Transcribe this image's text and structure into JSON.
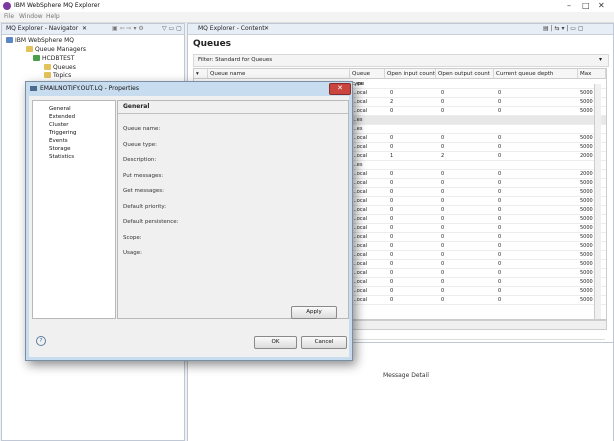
{
  "app": {
    "title": "IBM WebSphere MQ Explorer"
  },
  "menu": [
    "File",
    "Window",
    "Help"
  ],
  "navigator": {
    "title": "MQ Explorer - Navigator",
    "tree": [
      {
        "label": "IBM WebSphere MQ",
        "icon": "mq-root-icon"
      },
      {
        "label": "Queue Managers",
        "icon": "folder-icon"
      },
      {
        "label": "HCDBTEST",
        "icon": "queue-manager-icon"
      },
      {
        "label": "Queues",
        "icon": "folder-icon"
      },
      {
        "label": "Topics",
        "icon": "folder-icon"
      }
    ]
  },
  "content": {
    "title": "MQ Explorer - Content",
    "heading": "Queues",
    "filter": "Filter: Standard for Queues",
    "columns": [
      "Queue name",
      "Queue type",
      "Open input count",
      "Open output count",
      "Current queue depth",
      "Max"
    ],
    "rows": [
      {
        "type": "...es",
        "in": "",
        "out": "",
        "depth": "",
        "max": "",
        "grey": false
      },
      {
        "type": "...ocal",
        "in": "0",
        "out": "0",
        "depth": "0",
        "max": "5000",
        "grey": false
      },
      {
        "type": "...ocal",
        "in": "2",
        "out": "0",
        "depth": "0",
        "max": "5000",
        "grey": false
      },
      {
        "type": "...ocal",
        "in": "0",
        "out": "0",
        "depth": "0",
        "max": "5000",
        "grey": false
      },
      {
        "type": "...es",
        "in": "",
        "out": "",
        "depth": "",
        "max": "",
        "grey": true
      },
      {
        "type": "...es",
        "in": "",
        "out": "",
        "depth": "",
        "max": "",
        "grey": false
      },
      {
        "type": "...ocal",
        "in": "0",
        "out": "0",
        "depth": "0",
        "max": "5000",
        "grey": false
      },
      {
        "type": "...ocal",
        "in": "0",
        "out": "0",
        "depth": "0",
        "max": "5000",
        "grey": false
      },
      {
        "type": "...ocal",
        "in": "1",
        "out": "2",
        "depth": "0",
        "max": "2000",
        "grey": false
      },
      {
        "type": "...es",
        "in": "",
        "out": "",
        "depth": "",
        "max": "",
        "grey": false
      },
      {
        "type": "...ocal",
        "in": "0",
        "out": "0",
        "depth": "0",
        "max": "2000",
        "grey": false
      },
      {
        "type": "...ocal",
        "in": "0",
        "out": "0",
        "depth": "0",
        "max": "5000",
        "grey": false
      },
      {
        "type": "...ocal",
        "in": "0",
        "out": "0",
        "depth": "0",
        "max": "5000",
        "grey": false
      },
      {
        "type": "...ocal",
        "in": "0",
        "out": "0",
        "depth": "0",
        "max": "5000",
        "grey": false
      },
      {
        "type": "...ocal",
        "in": "0",
        "out": "0",
        "depth": "0",
        "max": "5000",
        "grey": false
      },
      {
        "type": "...ocal",
        "in": "0",
        "out": "0",
        "depth": "0",
        "max": "5000",
        "grey": false
      },
      {
        "type": "...ocal",
        "in": "0",
        "out": "0",
        "depth": "0",
        "max": "5000",
        "grey": false
      },
      {
        "type": "...ocal",
        "in": "0",
        "out": "0",
        "depth": "0",
        "max": "5000",
        "grey": false
      },
      {
        "type": "...ocal",
        "in": "0",
        "out": "0",
        "depth": "0",
        "max": "5000",
        "grey": false
      },
      {
        "type": "...ocal",
        "in": "0",
        "out": "0",
        "depth": "0",
        "max": "5000",
        "grey": false
      },
      {
        "type": "...ocal",
        "in": "0",
        "out": "0",
        "depth": "0",
        "max": "5000",
        "grey": false
      },
      {
        "type": "...ocal",
        "in": "0",
        "out": "0",
        "depth": "0",
        "max": "5000",
        "grey": false
      },
      {
        "type": "...ocal",
        "in": "0",
        "out": "0",
        "depth": "0",
        "max": "5000",
        "grey": false
      },
      {
        "type": "...ocal",
        "in": "0",
        "out": "0",
        "depth": "0",
        "max": "5000",
        "grey": false
      },
      {
        "type": "...ocal",
        "in": "0",
        "out": "0",
        "depth": "0",
        "max": "5000",
        "grey": false
      }
    ],
    "message_detail": "Message Detail"
  },
  "dialog": {
    "title": "EMAILNOTIFY.OUT.LQ - Properties",
    "categories": [
      "General",
      "Extended",
      "Cluster",
      "Triggering",
      "Events",
      "Storage",
      "Statistics"
    ],
    "panel_title": "General",
    "fields": [
      "Queue name:",
      "Queue type:",
      "Description:",
      "Put messages:",
      "Get messages:",
      "Default priority:",
      "Default persistence:",
      "Scope:",
      "Usage:"
    ],
    "apply": "Apply",
    "ok": "OK",
    "cancel": "Cancel",
    "help": "?"
  },
  "colors": {
    "dialog_frame": "#c8dcef",
    "close_button": "#c9453d"
  }
}
